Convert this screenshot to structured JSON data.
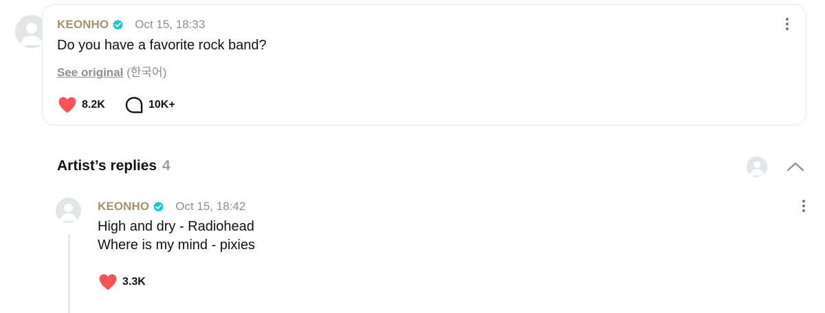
{
  "post": {
    "author": "KEONHO",
    "timestamp": "Oct 15, 18:33",
    "text": "Do you have a favorite rock band?",
    "see_original_label": "See original",
    "original_language": "(한국어)",
    "likes": "8.2K",
    "comments": "10K+"
  },
  "replies_section": {
    "title": "Artist’s replies",
    "count": "4"
  },
  "reply": {
    "author": "KEONHO",
    "timestamp": "Oct 15, 18:42",
    "lines": [
      "High and dry - Radiohead",
      "Where is my mind - pixies"
    ],
    "likes": "3.3K"
  },
  "colors": {
    "author_name": "#a39170",
    "verified_badge": "#1fc7c5",
    "heart": "#f4545a",
    "muted_text": "#8a8f94",
    "card_border": "#e6e8eb",
    "avatar_bg": "#e3e6e9"
  },
  "icons": {
    "verified": "verified-badge-icon",
    "like": "heart-icon",
    "comment": "speech-bubble-icon",
    "menu": "kebab-menu-icon",
    "collapse": "chevron-up-icon"
  }
}
